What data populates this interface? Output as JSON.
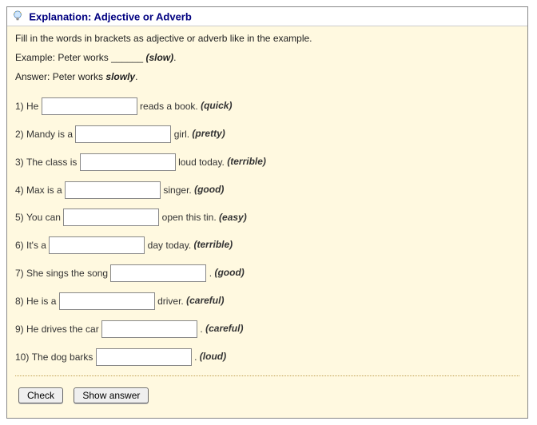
{
  "header": {
    "title": "Explanation: Adjective or Adverb",
    "icon": "lightbulb-icon"
  },
  "intro": "Fill in the words in brackets as adjective or adverb like in the example.",
  "example": {
    "prefix": "Example: Peter works",
    "blank": "______",
    "hint": "(slow)",
    "suffix": "."
  },
  "answer": {
    "label": "Answer:",
    "text_before": "Peter works",
    "text_em": "slowly",
    "text_after": "."
  },
  "questions": [
    {
      "n": "1)",
      "before": "He",
      "after": "reads a book.",
      "hint": "(quick)"
    },
    {
      "n": "2)",
      "before": "Mandy is a",
      "after": "girl.",
      "hint": "(pretty)"
    },
    {
      "n": "3)",
      "before": "The class is",
      "after": "loud today.",
      "hint": "(terrible)"
    },
    {
      "n": "4)",
      "before": "Max is a",
      "after": "singer.",
      "hint": "(good)"
    },
    {
      "n": "5)",
      "before": "You can",
      "after": "open this tin.",
      "hint": "(easy)"
    },
    {
      "n": "6)",
      "before": "It's a",
      "after": "day today.",
      "hint": "(terrible)"
    },
    {
      "n": "7)",
      "before": "She sings the song",
      "after": ".",
      "hint": "(good)"
    },
    {
      "n": "8)",
      "before": "He is a",
      "after": "driver.",
      "hint": "(careful)"
    },
    {
      "n": "9)",
      "before": "He drives the car",
      "after": ".",
      "hint": "(careful)"
    },
    {
      "n": "10)",
      "before": "The dog barks",
      "after": ".",
      "hint": "(loud)"
    }
  ],
  "buttons": {
    "check": "Check",
    "show_answer": "Show answer"
  }
}
